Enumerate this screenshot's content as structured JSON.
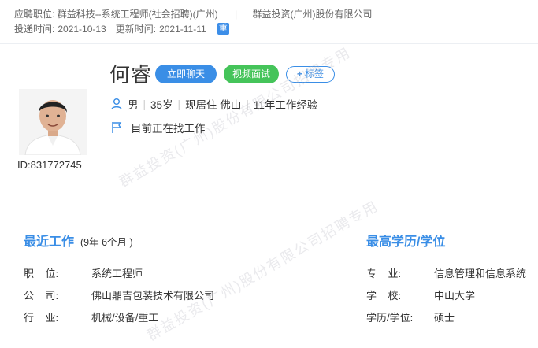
{
  "header": {
    "position_label": "应聘职位:",
    "position_value": "群益科技--系统工程师(社会招聘)(广州)",
    "separator": "|",
    "company": "群益投资(广州)股份有限公司",
    "submit_label": "投递时间:",
    "submit_date": "2021-10-13",
    "update_label": "更新时间:",
    "update_date": "2021-11-11",
    "duplicate_badge": "重"
  },
  "profile": {
    "name": "何睿",
    "chat_button": "立即聊天",
    "video_button": "视频面试",
    "tag_button": "标签",
    "tag_plus": "+",
    "gender": "男",
    "age": "35岁",
    "location": "现居住 佛山",
    "experience": "11年工作经验",
    "pipe": "|",
    "status": "目前正在找工作",
    "id": "ID:831772745"
  },
  "recent_work": {
    "title": "最近工作",
    "duration": "(9年 6个月 )",
    "fields": [
      {
        "label": "职    位:",
        "value": "系统工程师"
      },
      {
        "label": "公    司:",
        "value": "佛山鼎吉包装技术有限公司"
      },
      {
        "label": "行    业:",
        "value": "机械/设备/重工"
      }
    ]
  },
  "education": {
    "title": "最高学历/学位",
    "fields": [
      {
        "label": "专    业:",
        "value": "信息管理和信息系统"
      },
      {
        "label": "学    校:",
        "value": "中山大学"
      },
      {
        "label": "学历/学位:",
        "value": "硕士"
      }
    ]
  },
  "watermarks": [
    "群益投资(广州)股份有限公司招聘专用",
    "群益投资(广州)股份有限公司招聘专用"
  ],
  "colors": {
    "accent": "#3a8ee6",
    "video": "#45c45a"
  }
}
